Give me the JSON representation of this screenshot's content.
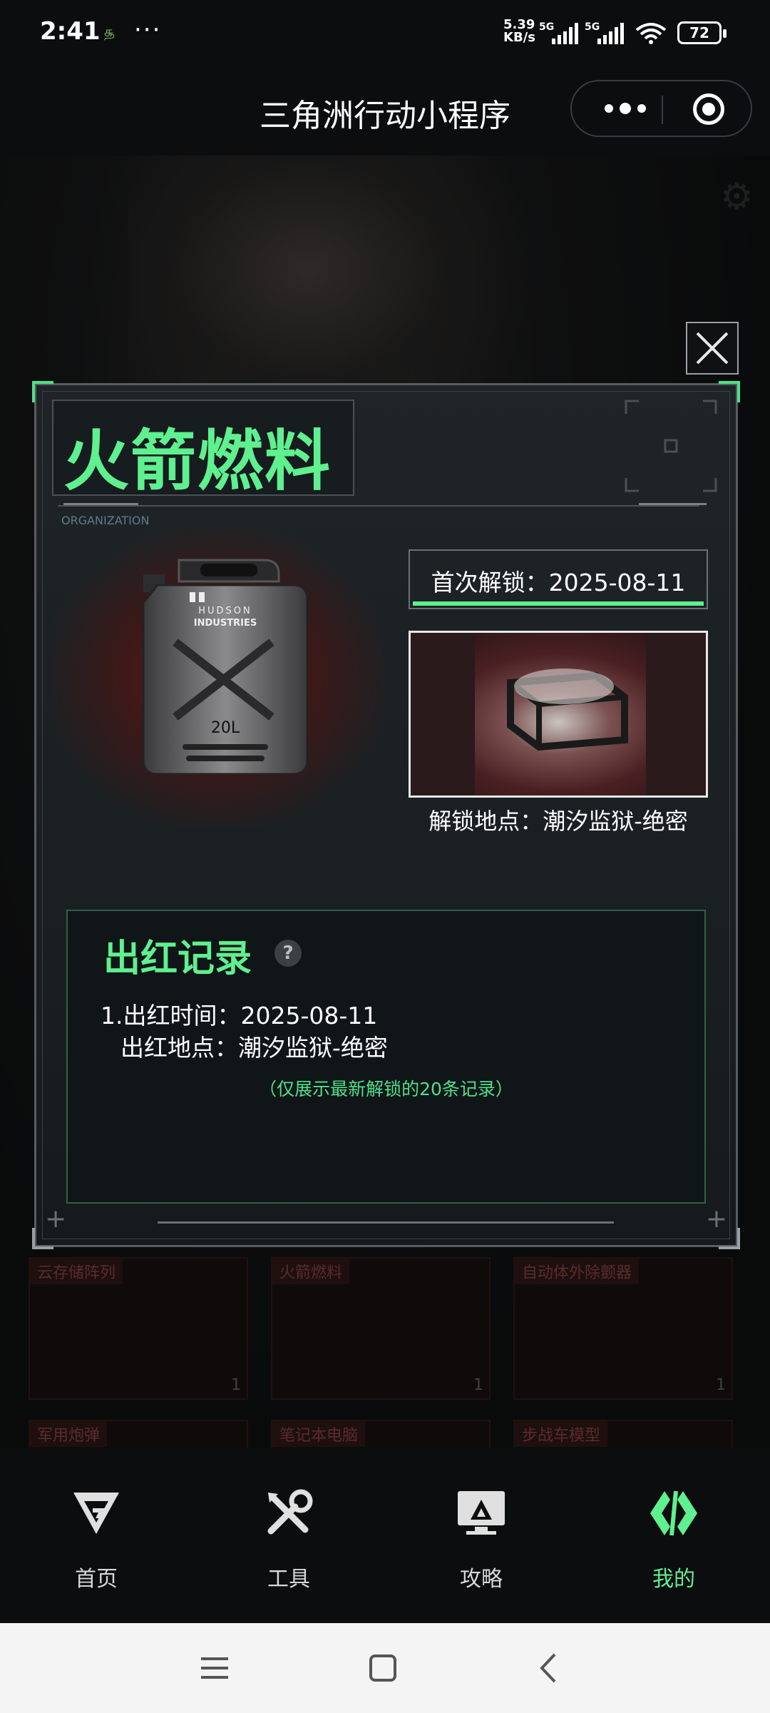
{
  "status_bar": {
    "time": "2:41",
    "dots": "···",
    "net_speed_value": "5.39",
    "net_speed_unit": "KB/s",
    "signal_1": "5G",
    "signal_2": "5G",
    "battery": "72"
  },
  "title_bar": {
    "title": "三角洲行动小程序"
  },
  "dialog": {
    "item_name": "火箭燃料",
    "org_label": "ORGANIZATION",
    "first_unlock": "首次解锁：2025-08-11",
    "unlock_location": "解锁地点：潮汐监狱-绝密",
    "jerrycan_brand": "HUDSON",
    "jerrycan_brand2": "INDUSTRIES",
    "jerrycan_volume": "20L",
    "records": {
      "title": "出红记录",
      "help": "?",
      "entry_time": "1.出红时间：2025-08-11",
      "entry_location": "出红地点：潮汐监狱-绝密",
      "note": "（仅展示最新解锁的20条记录）"
    }
  },
  "background_cards": [
    {
      "label": "云存储阵列",
      "count": "1"
    },
    {
      "label": "火箭燃料",
      "count": "1"
    },
    {
      "label": "自动体外除颤器",
      "count": "1"
    },
    {
      "label": "军用炮弹"
    },
    {
      "label": "笔记本电脑"
    },
    {
      "label": "步战车模型"
    }
  ],
  "bottom_nav": [
    {
      "label": "首页",
      "icon": "home-logo-icon"
    },
    {
      "label": "工具",
      "icon": "tools-icon"
    },
    {
      "label": "攻略",
      "icon": "guide-monitor-icon"
    },
    {
      "label": "我的",
      "icon": "profile-logo-icon",
      "active": true
    }
  ],
  "colors": {
    "accent": "#5ff08f",
    "background": "#0c0e10",
    "red_glow": "#6a2020"
  }
}
